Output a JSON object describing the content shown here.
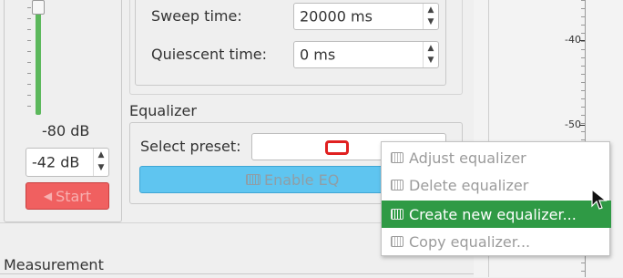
{
  "left_panel": {
    "slider_value": "-80 dB",
    "gain_value": "-42 dB",
    "start_label": "Start"
  },
  "sweep": {
    "sweep_time_label": "Sweep time:",
    "sweep_time_value": "20000 ms",
    "quiescent_label": "Quiescent time:",
    "quiescent_value": "0 ms"
  },
  "equalizer": {
    "group_title": "Equalizer",
    "select_preset_label": "Select preset:",
    "enable_eq_label": "Enable EQ"
  },
  "measurement": {
    "group_title": "Measurement"
  },
  "plot": {
    "tick_labels": [
      "-40",
      "-50"
    ]
  },
  "context_menu": {
    "items": [
      {
        "label": "Adjust equalizer",
        "enabled": false
      },
      {
        "label": "Delete equalizer",
        "enabled": false
      },
      {
        "label": "Create new equalizer...",
        "enabled": true,
        "selected": true
      },
      {
        "label": "Copy equalizer...",
        "enabled": false
      }
    ]
  },
  "colors": {
    "selection_green": "#2f9a45",
    "start_button_red": "#f06060",
    "enable_eq_blue": "#5fc5f0",
    "slider_green": "#5cb85c"
  }
}
